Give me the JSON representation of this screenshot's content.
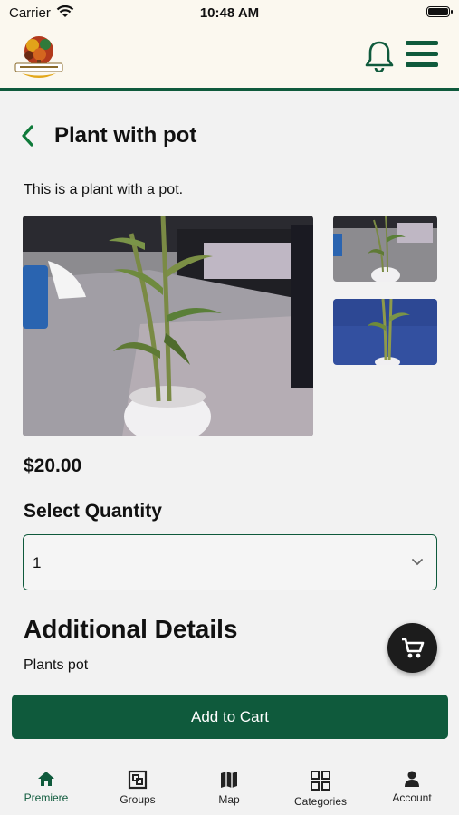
{
  "status": {
    "carrier": "Carrier",
    "time": "10:48 AM"
  },
  "product": {
    "title": "Plant with pot",
    "description": "This is a plant with a pot.",
    "price": "$20.00",
    "quantity_label": "Select Quantity",
    "quantity_value": "1",
    "details_title": "Additional Details",
    "details_text": "Plants pot"
  },
  "actions": {
    "add_to_cart": "Add to Cart"
  },
  "tabs": [
    {
      "label": "Premiere",
      "icon": "home-icon"
    },
    {
      "label": "Groups",
      "icon": "groups-icon"
    },
    {
      "label": "Map",
      "icon": "map-icon"
    },
    {
      "label": "Categories",
      "icon": "grid-icon"
    },
    {
      "label": "Account",
      "icon": "person-icon"
    }
  ],
  "colors": {
    "brand": "#0f5a3c",
    "header_bg": "#fbf8ef",
    "page_bg": "#f2f2f2"
  }
}
